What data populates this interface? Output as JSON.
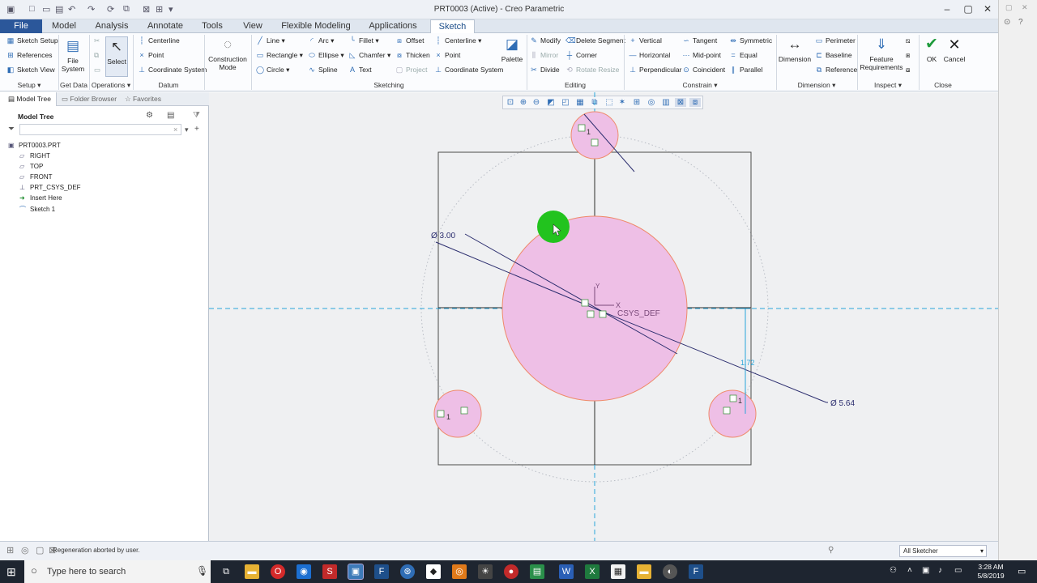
{
  "window": {
    "title": "PRT0003 (Active) - Creo Parametric"
  },
  "tabs": [
    {
      "label": "File"
    },
    {
      "label": "Model"
    },
    {
      "label": "Analysis"
    },
    {
      "label": "Annotate"
    },
    {
      "label": "Tools"
    },
    {
      "label": "View"
    },
    {
      "label": "Flexible Modeling"
    },
    {
      "label": "Applications"
    },
    {
      "label": "Sketch"
    }
  ],
  "ribbon": {
    "setup": {
      "sketch_setup": "Sketch Setup",
      "references": "References",
      "sketch_view": "Sketch View",
      "label": "Setup"
    },
    "get_data": {
      "file_system": "File System",
      "label": "Get Data"
    },
    "operations": {
      "select": "Select",
      "label": "Operations"
    },
    "datum": {
      "centerline": "Centerline",
      "point": "Point",
      "coordinate_system": "Coordinate System",
      "label": "Datum"
    },
    "construction_mode": "Construction Mode",
    "sketching": {
      "line": "Line",
      "rectangle": "Rectangle",
      "circle": "Circle",
      "arc": "Arc",
      "ellipse": "Ellipse",
      "spline": "Spline",
      "fillet": "Fillet",
      "chamfer": "Chamfer",
      "text": "Text",
      "offset": "Offset",
      "thicken": "Thicken",
      "project": "Project",
      "centerline": "Centerline",
      "point": "Point",
      "coordinate_system": "Coordinate System",
      "palette": "Palette",
      "label": "Sketching"
    },
    "editing": {
      "modify": "Modify",
      "mirror": "Mirror",
      "divide": "Divide",
      "delete_segment": "Delete Segment",
      "corner": "Corner",
      "rotate_resize": "Rotate Resize",
      "label": "Editing"
    },
    "constrain": {
      "vertical": "Vertical",
      "horizontal": "Horizontal",
      "perpendicular": "Perpendicular",
      "tangent": "Tangent",
      "mid_point": "Mid-point",
      "coincident": "Coincident",
      "symmetric": "Symmetric",
      "equal": "Equal",
      "parallel": "Parallel",
      "label": "Constrain"
    },
    "dimension": {
      "dimension": "Dimension",
      "perimeter": "Perimeter",
      "baseline": "Baseline",
      "reference": "Reference",
      "label": "Dimension"
    },
    "inspect": {
      "feature_requirements": "Feature Requirements",
      "label": "Inspect"
    },
    "close": {
      "ok": "OK",
      "cancel": "Cancel",
      "label": "Close"
    }
  },
  "left_panel": {
    "tabs": [
      {
        "label": "Model Tree"
      },
      {
        "label": "Folder Browser"
      },
      {
        "label": "Favorites"
      }
    ],
    "header": "Model Tree",
    "items": [
      {
        "label": "PRT0003.PRT"
      },
      {
        "label": "RIGHT"
      },
      {
        "label": "TOP"
      },
      {
        "label": "FRONT"
      },
      {
        "label": "PRT_CSYS_DEF"
      },
      {
        "label": "Insert Here"
      },
      {
        "label": "Sketch 1"
      }
    ]
  },
  "sketch": {
    "dim_small": "Ø 3.00",
    "dim_large": "Ø 5.64",
    "dim_vertical": "1.72",
    "csys_label": "CSYS_DEF",
    "x_label": "X",
    "y_label": "Y",
    "equal_marker": "1"
  },
  "status": {
    "message": "Regeneration aborted by user.",
    "filter": "All Sketcher"
  },
  "taskbar": {
    "search_placeholder": "Type here to search",
    "time": "3:28 AM",
    "date": "5/8/2019"
  },
  "colors": {
    "sketch_fill": "#eebfe6",
    "sketch_stroke": "#ef8a6a",
    "cursor_highlight": "#22c31e",
    "centerline": "#2aa6d9",
    "accent": "#2b579a"
  }
}
